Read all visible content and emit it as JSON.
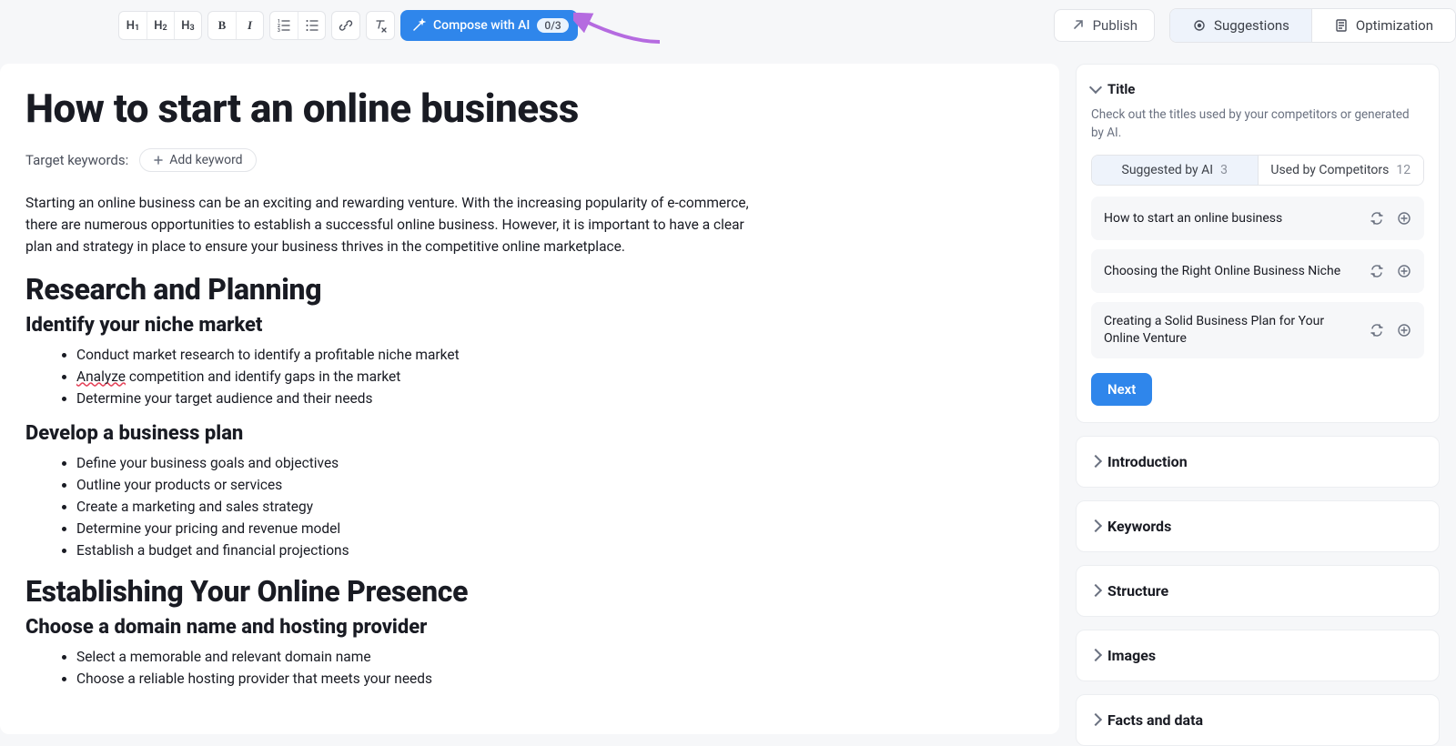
{
  "toolbar": {
    "h1": "H",
    "h1s": "1",
    "h2": "H",
    "h2s": "2",
    "h3": "H",
    "h3s": "3",
    "bold": "B",
    "italic": "I",
    "compose_label": "Compose with AI",
    "compose_count": "0/3",
    "publish_label": "Publish",
    "suggestions_label": "Suggestions",
    "optimization_label": "Optimization"
  },
  "article": {
    "title": "How to start an online business",
    "target_keywords_label": "Target keywords:",
    "add_keyword_label": "Add keyword",
    "intro": "Starting an online business can be an exciting and rewarding venture. With the increasing popularity of e-commerce, there are numerous opportunities to establish a successful online business. However, it is important to have a clear plan and strategy in place to ensure your business thrives in the competitive online marketplace.",
    "h2_1": "Research and Planning",
    "h3_1": "Identify your niche market",
    "list1": [
      "Conduct market research to identify a profitable niche market",
      "Analyze competition and identify gaps in the market",
      "Determine your target audience and their needs"
    ],
    "list1_spell_word": "Analyze",
    "list1_spell_rest": " competition and identify gaps in the market",
    "h3_2": "Develop a business plan",
    "list2": [
      "Define your business goals and objectives",
      "Outline your products or services",
      "Create a marketing and sales strategy",
      "Determine your pricing and revenue model",
      "Establish a budget and financial projections"
    ],
    "h2_2": "Establishing Your Online Presence",
    "h3_3": "Choose a domain name and hosting provider",
    "list3": [
      "Select a memorable and relevant domain name",
      "Choose a reliable hosting provider that meets your needs"
    ]
  },
  "side": {
    "title_section": {
      "header": "Title",
      "sub": "Check out the titles used by your competitors or generated by AI.",
      "tabs": {
        "ai_label": "Suggested by AI",
        "ai_count": "3",
        "comp_label": "Used by Competitors",
        "comp_count": "12"
      },
      "suggestions": [
        "How to start an online business",
        "Choosing the Right Online Business Niche",
        "Creating a Solid Business Plan for Your Online Venture"
      ],
      "next_label": "Next"
    },
    "collapsed": [
      "Introduction",
      "Keywords",
      "Structure",
      "Images",
      "Facts and data"
    ]
  }
}
